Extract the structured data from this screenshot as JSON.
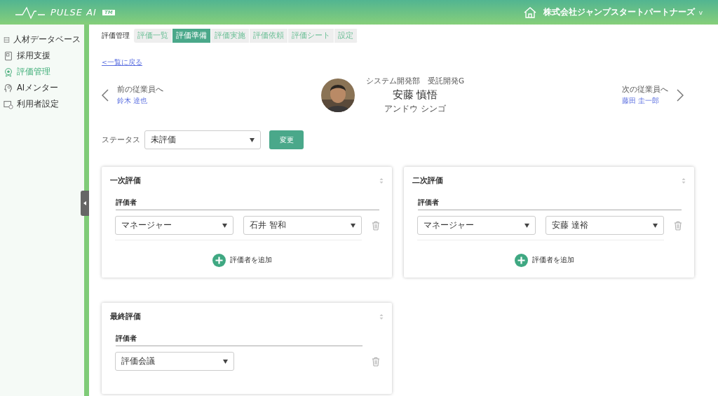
{
  "header": {
    "logo_text": "PULSE AI",
    "logo_badge": "TM",
    "company": "株式会社ジャンプスタートパートナーズ",
    "company_caret": "v"
  },
  "sidebar": {
    "items": [
      {
        "label": "人材データベース",
        "selected": false
      },
      {
        "label": "採用支援",
        "selected": false
      },
      {
        "label": "評価管理",
        "selected": true
      },
      {
        "label": "AIメンター",
        "selected": false
      },
      {
        "label": "利用者設定",
        "selected": false
      }
    ]
  },
  "section_title": "評価管理",
  "tabs": [
    {
      "label": "評価一覧",
      "selected": false
    },
    {
      "label": "評価準備",
      "selected": true
    },
    {
      "label": "評価実施",
      "selected": false
    },
    {
      "label": "評価依頼",
      "selected": false
    },
    {
      "label": "評価シート",
      "selected": false
    },
    {
      "label": "設定",
      "selected": false
    }
  ],
  "back_link": "<一覧に戻る",
  "employee": {
    "department": "システム開発部　受託開発G",
    "name": "安藤 慎悟",
    "kana": "アンドウ シンゴ"
  },
  "prev": {
    "label": "前の従業員へ",
    "name": "鈴木 達也"
  },
  "next": {
    "label": "次の従業員へ",
    "name": "藤田 圭一郎"
  },
  "status": {
    "label": "ステータス",
    "value": "未評価",
    "button": "変更"
  },
  "panels": [
    {
      "title": "一次評価",
      "evaluator_label": "評価者",
      "rows": [
        {
          "role": "マネージャー",
          "person": "石井 智和"
        }
      ],
      "add_label": "評価者を追加"
    },
    {
      "title": "二次評価",
      "evaluator_label": "評価者",
      "rows": [
        {
          "role": "マネージャー",
          "person": "安藤 達裕"
        }
      ],
      "add_label": "評価者を追加"
    },
    {
      "title": "最終評価",
      "evaluator_label": "評価者",
      "rows": [
        {
          "role": "評価会議"
        }
      ]
    }
  ]
}
